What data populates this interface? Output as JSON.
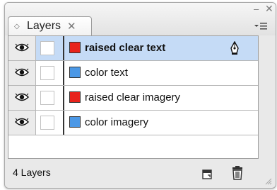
{
  "panel": {
    "tab_title": "Layers",
    "collapse_glyph": "◇",
    "close_tab_glyph": "✕",
    "minimize_glyph": "–",
    "close_glyph": "✕",
    "menu_glyph": "▾☰"
  },
  "layers": [
    {
      "name": "raised clear text",
      "color": "#e8231c",
      "selected": true,
      "icon": "pen-nib-icon"
    },
    {
      "name": "color text",
      "color": "#4b98e6",
      "selected": false
    },
    {
      "name": "raised clear imagery",
      "color": "#e8231c",
      "selected": false
    },
    {
      "name": "color imagery",
      "color": "#4b98e6",
      "selected": false
    }
  ],
  "footer": {
    "count_label": "4 Layers"
  },
  "icons": {
    "visibility": "eye-icon",
    "new_layer": "new-layer-icon",
    "delete": "trash-icon",
    "resize": "resize-grip-icon"
  },
  "colors": {
    "selection": "#c5dbf6",
    "panel_bg": "#e9e9e9"
  }
}
